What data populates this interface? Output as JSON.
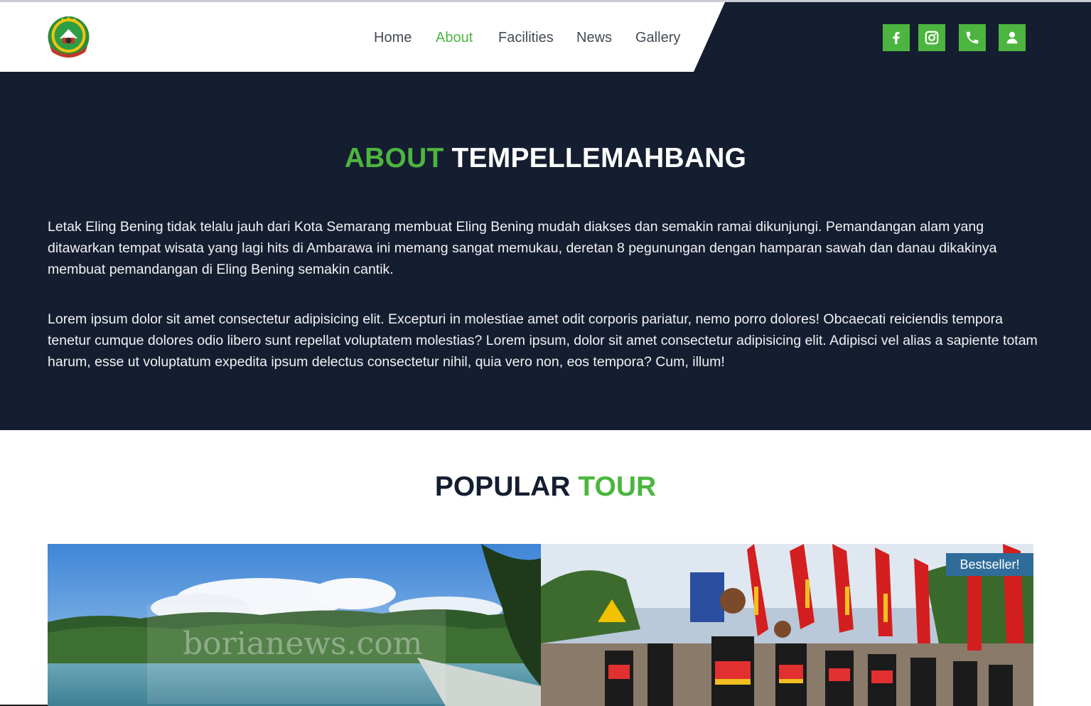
{
  "header": {
    "logo_icon": "regency-emblem-logo",
    "nav": [
      {
        "label": "Home",
        "active": false
      },
      {
        "label": "About",
        "active": true
      },
      {
        "label": "Facilities",
        "active": false
      },
      {
        "label": "News",
        "active": false
      },
      {
        "label": "Gallery",
        "active": false
      }
    ],
    "social_icons": [
      "facebook-icon",
      "instagram-icon",
      "phone-icon",
      "user-icon"
    ]
  },
  "about": {
    "title_accent": "ABOUT",
    "title_main": "TEMPELLEMAHBANG",
    "paragraph_1": "Letak Eling Bening tidak telalu jauh dari Kota Semarang membuat Eling Bening mudah diakses dan semakin ramai dikunjungi. Pemandangan alam yang ditawarkan tempat wisata yang lagi hits di Ambarawa ini memang sangat memukau, deretan 8 pegunungan dengan hamparan sawah dan danau dikakinya membuat pemandangan di Eling Bening semakin cantik.",
    "paragraph_2": "Lorem ipsum dolor sit amet consectetur adipisicing elit. Excepturi in molestiae amet odit corporis pariatur, nemo porro dolores! Obcaecati reiciendis tempora tenetur cumque dolores odio libero sunt repellat voluptatem molestias? Lorem ipsum, dolor sit amet consectetur adipisicing elit. Adipisci vel alias a sapiente totam harum, esse ut voluptatum expedita ipsum delectus consectetur nihil, quia vero non, eos tempora? Cum, illum!"
  },
  "popular": {
    "title_main": "POPULAR",
    "title_accent": "TOUR",
    "cards": [
      {
        "image": "lake-landscape-photo",
        "watermark": "borianews.com"
      },
      {
        "image": "festival-parade-photo",
        "badge": "Bestseller!"
      }
    ]
  },
  "colors": {
    "accent_green": "#4cb53f",
    "navy": "#151d30",
    "badge_blue": "#2f6c9a"
  }
}
